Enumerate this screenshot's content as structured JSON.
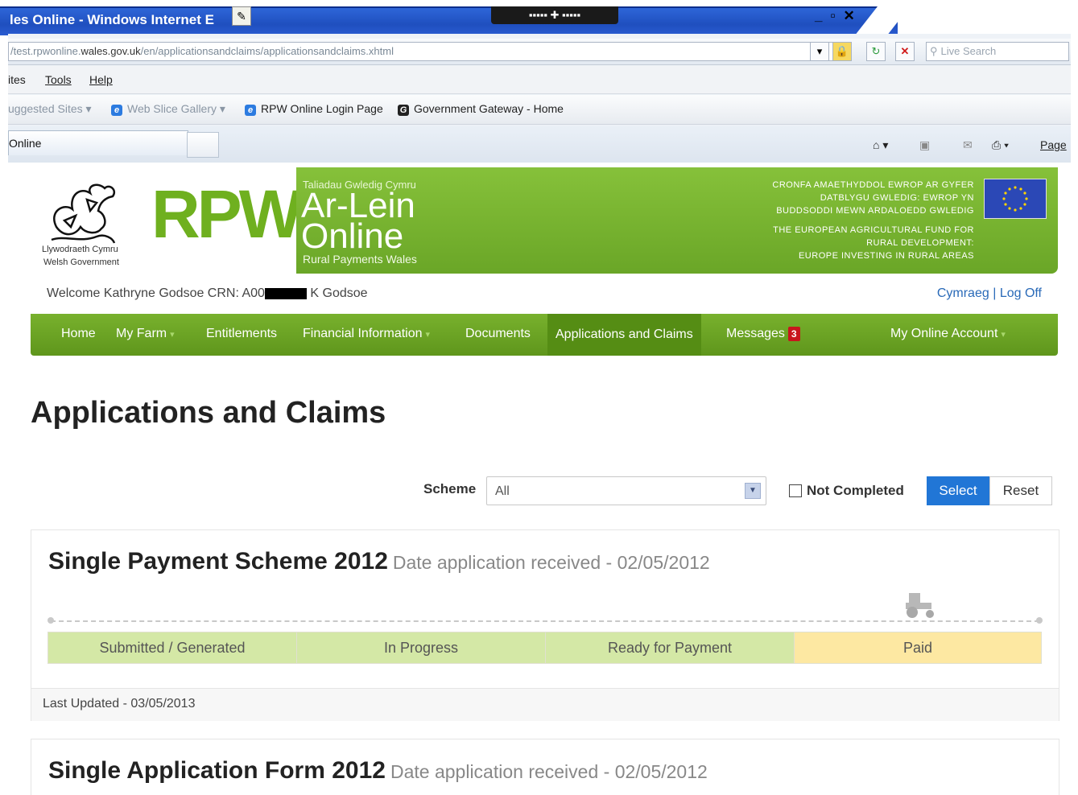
{
  "browser": {
    "title": "les Online - Windows Internet E",
    "address": {
      "prefix": "/test.rpwonline.",
      "domain": "wales.gov.uk",
      "path": "/en/applicationsandclaims/applicationsandclaims.xhtml"
    },
    "search_placeholder": "Live Search",
    "menu": [
      "ites",
      "Tools",
      "Help"
    ],
    "favorites": {
      "suggested": "uggested Sites ▾",
      "web_slice": "Web Slice Gallery ▾",
      "rpw_login": "RPW Online Login Page",
      "gateway": "Government Gateway - Home"
    },
    "tab_label": "Online",
    "page_menu": "Page"
  },
  "banner": {
    "gov_cy": "Llywodraeth Cymru",
    "gov_en": "Welsh Government",
    "rpw": "RPW",
    "tagline_cy": "Taliadau Gwledig Cymru",
    "ar_lein": "Ar-Lein",
    "online": "Online",
    "rural_payments": "Rural Payments Wales",
    "eu_lines": [
      "CRONFA AMAETHYDDOL EWROP AR GYFER",
      "DATBLYGU GWLEDIG: EWROP YN",
      "BUDDSODDI MEWN ARDALOEDD GWLEDIG",
      "THE EUROPEAN AGRICULTURAL FUND FOR",
      "RURAL DEVELOPMENT:",
      "EUROPE INVESTING IN RURAL AREAS"
    ]
  },
  "user": {
    "welcome": "Welcome Kathryne Godsoe CRN: A00",
    "suffix": "K Godsoe",
    "cymraeg": "Cymraeg",
    "separator": "|",
    "log_off": "Log Off"
  },
  "nav": {
    "home": "Home",
    "my_farm": "My Farm",
    "entitlements": "Entitlements",
    "financial": "Financial Information",
    "documents": "Documents",
    "applications": "Applications and Claims",
    "messages": "Messages",
    "messages_count": "3",
    "account": "My Online Account"
  },
  "page": {
    "title": "Applications and Claims"
  },
  "filter": {
    "scheme_label": "Scheme",
    "scheme_value": "All",
    "not_completed": "Not Completed",
    "select": "Select",
    "reset": "Reset"
  },
  "cards": [
    {
      "title": "Single Payment Scheme 2012",
      "date": "Date application received - 02/05/2012",
      "stages": [
        "Submitted / Generated",
        "In Progress",
        "Ready for Payment",
        "Paid"
      ],
      "updated": "Last Updated - 03/05/2013"
    },
    {
      "title": "Single Application Form 2012",
      "date": "Date application received - 02/05/2012"
    }
  ],
  "colors": {
    "rpw_green": "#6fb01f",
    "nav_green": "#6aa627",
    "stage_done": "#d4e8a6",
    "stage_paid": "#fde8a2",
    "select_blue": "#2176d6",
    "badge_red": "#c8161d"
  }
}
